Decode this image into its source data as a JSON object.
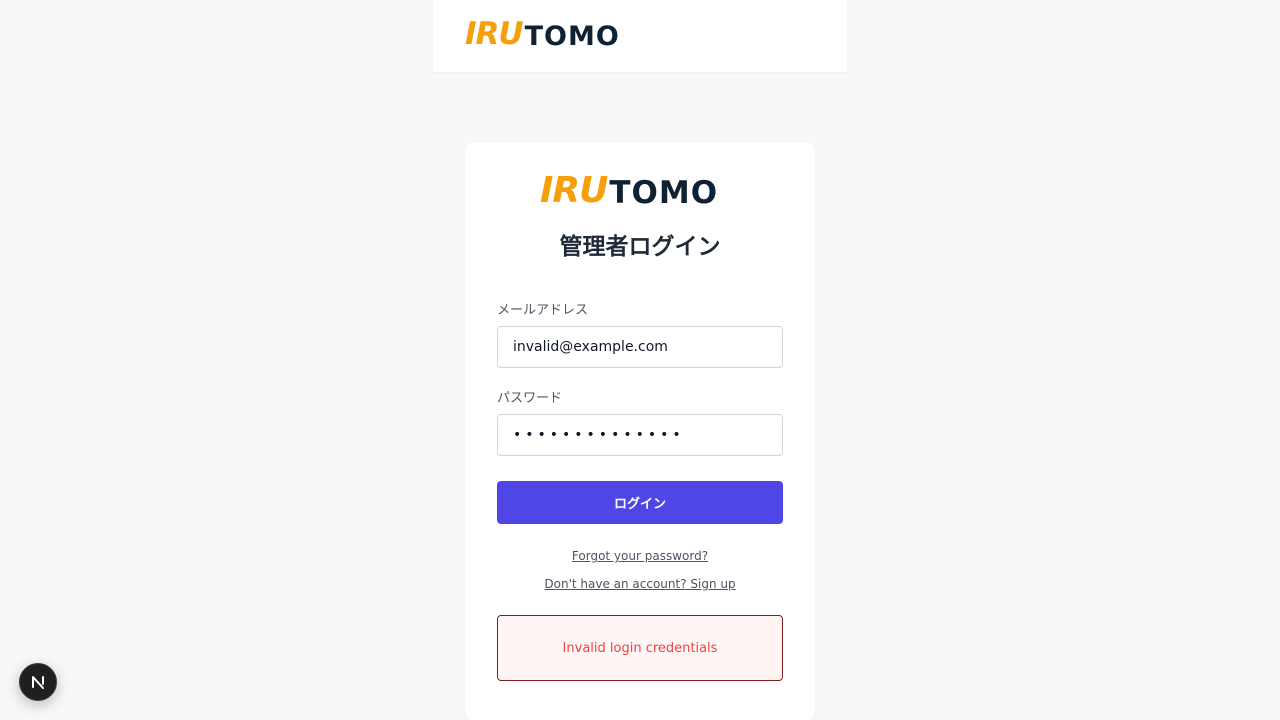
{
  "brand": {
    "logo_primary": "IRU",
    "logo_secondary": "TOMO",
    "primary_color": "#f5a00a",
    "secondary_color": "#0f2233"
  },
  "login": {
    "title": "管理者ログイン",
    "email_label": "メールアドレス",
    "email_value": "invalid@example.com",
    "password_label": "パスワード",
    "password_value": "••••••••••••••",
    "submit_label": "ログイン",
    "submit_color": "#4f46e5",
    "forgot_link": "Forgot your password?",
    "signup_link": "Don't have an account? Sign up",
    "error_message": "Invalid login credentials"
  },
  "devtools": {
    "badge_letter": "N",
    "badge_icon": "nextjs-icon"
  }
}
